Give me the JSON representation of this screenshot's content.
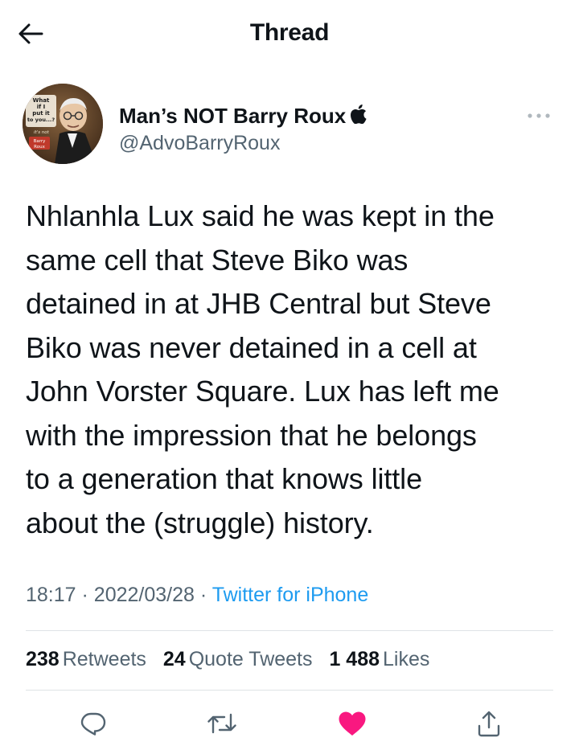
{
  "header": {
    "title": "Thread"
  },
  "author": {
    "display_name": "Man’s NOT Barry Roux",
    "handle": "@AdvoBarryRoux",
    "avatar_caption": "What if I put it to you...? It's not Barry Roux",
    "badge_icon": "apple-icon"
  },
  "tweet": {
    "text": "Nhlanhla Lux said he was kept in the\nsame cell that Steve Biko was\ndetained in at JHB Central but Steve\nBiko was never detained in a cell at\nJohn Vorster Square. Lux has left me\nwith the impression that he belongs\nto a generation that knows little\nabout the (struggle) history.",
    "time": "18:17",
    "date": "2022/03/28",
    "separator": "·",
    "source": "Twitter for iPhone"
  },
  "stats": {
    "retweets_count": "238",
    "retweets_label": "Retweets",
    "quotes_count": "24",
    "quotes_label": "Quote Tweets",
    "likes_count": "1 488",
    "likes_label": "Likes"
  },
  "colors": {
    "accent": "#1d9bf0",
    "like": "#f91880",
    "secondary_text": "#536471",
    "icon": "#536471"
  },
  "actions": {
    "reply_icon": "reply-icon",
    "retweet_icon": "retweet-icon",
    "like_icon": "heart-icon",
    "share_icon": "share-icon",
    "liked": true
  }
}
